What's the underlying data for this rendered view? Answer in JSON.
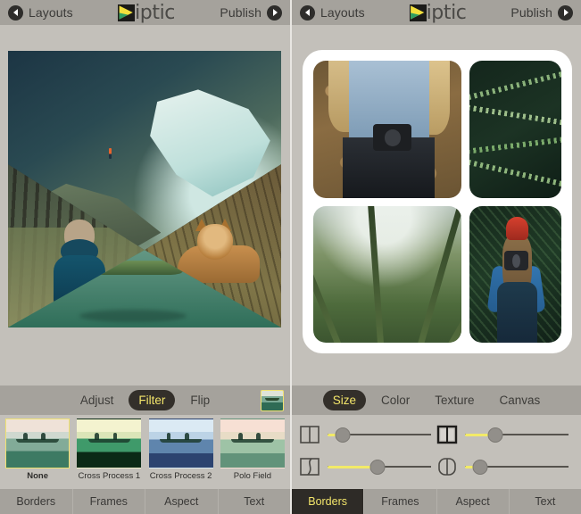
{
  "app": {
    "title": "Diptic",
    "logo_text": "iptic",
    "logo_colors": {
      "yellow": "#f2e03c",
      "green": "#2f9e63",
      "dark": "#1b1b19"
    },
    "accent_yellow": "#f3e56a",
    "toolbar_bg": "#a5a29c",
    "canvas_bg": "#c3c0ba"
  },
  "nav": {
    "back_label": "Layouts",
    "back_icon": "circle-left-arrow-icon",
    "publish_label": "Publish",
    "publish_icon": "circle-right-arrow-icon"
  },
  "left_panel": {
    "collage": {
      "layout": "diagonal-four-panel",
      "cells": [
        {
          "name": "mountain-lake-photo",
          "description": "Hiker on mountain ridge above turquoise lake"
        },
        {
          "name": "forest-person-photo",
          "description": "Person in blue hooded coat facing pine forest"
        },
        {
          "name": "fox-photo",
          "description": "Red fox resting in grass"
        },
        {
          "name": "canoe-photo",
          "description": "Two people paddling a canoe on calm green water"
        }
      ]
    },
    "subbar": {
      "items": [
        {
          "label": "Adjust",
          "active": false
        },
        {
          "label": "Filter",
          "active": true
        },
        {
          "label": "Flip",
          "active": false
        }
      ],
      "preview_thumb_name": "selected-cell-preview"
    },
    "filters": [
      {
        "label": "None",
        "active": true,
        "swatch": "fx-none"
      },
      {
        "label": "Cross Process 1",
        "active": false,
        "swatch": "fx-cp1"
      },
      {
        "label": "Cross Process 2",
        "active": false,
        "swatch": "fx-cp2"
      },
      {
        "label": "Polo Field",
        "active": false,
        "swatch": "fx-polo"
      }
    ],
    "tabs": [
      {
        "label": "Borders",
        "active": false
      },
      {
        "label": "Frames",
        "active": false
      },
      {
        "label": "Aspect",
        "active": false
      },
      {
        "label": "Text",
        "active": false
      }
    ]
  },
  "right_panel": {
    "collage": {
      "layout": "two-by-two-rounded",
      "canvas_color": "#ffffff",
      "cells": [
        {
          "name": "girl-holding-camera-photo",
          "description": "Woman in denim shirt holding vintage camera"
        },
        {
          "name": "fern-leaves-photo",
          "description": "Green fern fronds close-up"
        },
        {
          "name": "looking-up-trees-photo",
          "description": "Upward view of tall trees"
        },
        {
          "name": "red-beanie-photographer-photo",
          "description": "Woman in red beanie shooting with camera"
        }
      ]
    },
    "subbar": {
      "items": [
        {
          "label": "Size",
          "active": true
        },
        {
          "label": "Color",
          "active": false
        },
        {
          "label": "Texture",
          "active": false
        },
        {
          "label": "Canvas",
          "active": false
        }
      ]
    },
    "sliders": [
      {
        "icon": "inner-border-width-icon",
        "value": 14
      },
      {
        "icon": "outer-border-width-icon",
        "value": 28
      },
      {
        "icon": "border-curvature-icon",
        "value": 46
      },
      {
        "icon": "corner-rounding-icon",
        "value": 14
      }
    ],
    "tabs": [
      {
        "label": "Borders",
        "active": true
      },
      {
        "label": "Frames",
        "active": false
      },
      {
        "label": "Aspect",
        "active": false
      },
      {
        "label": "Text",
        "active": false
      }
    ]
  }
}
